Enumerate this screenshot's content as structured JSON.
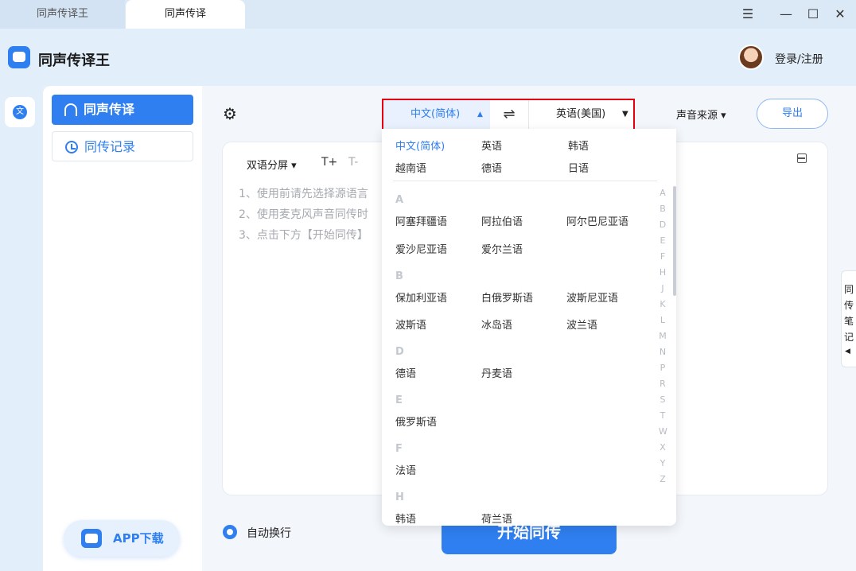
{
  "tabs": [
    {
      "label": "同声传译王",
      "active": false
    },
    {
      "label": "同声传译",
      "active": true
    }
  ],
  "window_controls": {
    "menu": "☰",
    "minimize": "—",
    "maximize": "☐",
    "close": "✕"
  },
  "header": {
    "app_title": "同声传译王",
    "login_label": "登录/注册"
  },
  "rail": {
    "icon_glyph": "文"
  },
  "sidebar": {
    "items": [
      {
        "label": "同声传译",
        "icon": "headphone-icon",
        "active": true
      },
      {
        "label": "同传记录",
        "icon": "clock-icon",
        "active": false
      }
    ],
    "app_download": "APP下载"
  },
  "toolbar": {
    "gear_glyph": "⚙",
    "source_language": "中文(简体)",
    "source_caret": "▲",
    "swap_glyph": "⇌",
    "target_language": "英语(美国)",
    "target_caret": "▼",
    "sound_source": "声音来源 ▾",
    "export_label": "导出"
  },
  "panel": {
    "mode_label": "双语分屏 ▾",
    "font_increase": "T+",
    "font_decrease": "T-",
    "hints": [
      "1、使用前请先选择源语言",
      "2、使用麦克风声音同传时",
      "3、点击下方【开始同传】"
    ]
  },
  "bottom": {
    "auto_wrap": "自动换行",
    "start_label": "开始同传"
  },
  "notes_tab": {
    "chars": [
      "同",
      "传",
      "笔",
      "记"
    ],
    "caret": "◀"
  },
  "dropdown": {
    "recent": [
      "中文(简体)",
      "英语",
      "韩语",
      "越南语",
      "德语",
      "日语"
    ],
    "groups": [
      {
        "letter": "A",
        "items": [
          "阿塞拜疆语",
          "阿拉伯语",
          "阿尔巴尼亚语",
          "爱沙尼亚语",
          "爱尔兰语"
        ]
      },
      {
        "letter": "B",
        "items": [
          "保加利亚语",
          "白俄罗斯语",
          "波斯尼亚语",
          "波斯语",
          "冰岛语",
          "波兰语"
        ]
      },
      {
        "letter": "D",
        "items": [
          "德语",
          "丹麦语"
        ]
      },
      {
        "letter": "E",
        "items": [
          "俄罗斯语"
        ]
      },
      {
        "letter": "F",
        "items": [
          "法语"
        ]
      },
      {
        "letter": "H",
        "items": [
          "韩语",
          "荷兰语"
        ]
      }
    ],
    "alphabet": [
      "A",
      "B",
      "D",
      "E",
      "F",
      "H",
      "J",
      "K",
      "L",
      "M",
      "N",
      "P",
      "R",
      "S",
      "T",
      "W",
      "X",
      "Y",
      "Z"
    ]
  },
  "colors": {
    "accent": "#2f7ff0",
    "highlight_border": "#e6000f"
  }
}
